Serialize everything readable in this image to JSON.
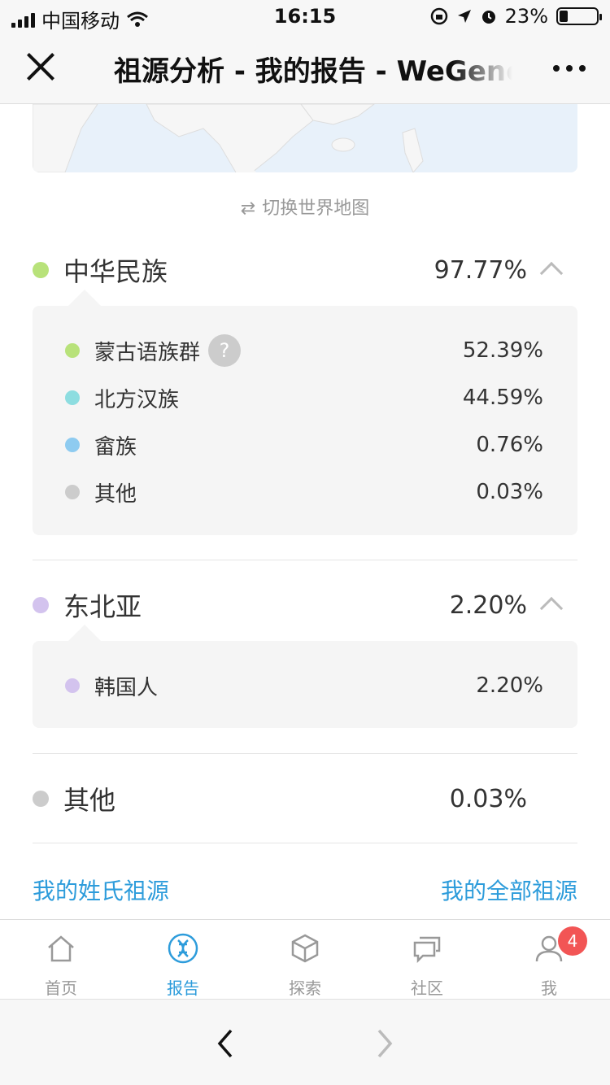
{
  "status_bar": {
    "carrier": "中国移动",
    "time": "16:15",
    "battery": "23%"
  },
  "nav": {
    "title": "祖源分析 - 我的报告 - WeGene"
  },
  "switch_map": {
    "icon": "swap-icon",
    "label": "切换世界地图"
  },
  "regions": [
    {
      "name": "中华民族",
      "percent": "97.77%",
      "color": "#b8e27a",
      "items": [
        {
          "name": "蒙古语族群",
          "percent": "52.39%",
          "color": "#b8e27a",
          "help": "?"
        },
        {
          "name": "北方汉族",
          "percent": "44.59%",
          "color": "#8ddde0"
        },
        {
          "name": "畲族",
          "percent": "0.76%",
          "color": "#8ecbf0"
        },
        {
          "name": "其他",
          "percent": "0.03%",
          "color": "#cccccc"
        }
      ]
    },
    {
      "name": "东北亚",
      "percent": "2.20%",
      "color": "#d3c3ee",
      "items": [
        {
          "name": "韩国人",
          "percent": "2.20%",
          "color": "#d3c3ee"
        }
      ]
    },
    {
      "name": "其他",
      "percent": "0.03%",
      "color": "#cccccc"
    }
  ],
  "links": {
    "surname": "我的姓氏祖源",
    "all": "我的全部祖源"
  },
  "tabs": [
    {
      "label": "首页",
      "icon": "home-icon"
    },
    {
      "label": "报告",
      "icon": "dna-icon"
    },
    {
      "label": "探索",
      "icon": "cube-icon"
    },
    {
      "label": "社区",
      "icon": "chat-icon"
    },
    {
      "label": "我",
      "icon": "user-icon",
      "badge": "4"
    }
  ],
  "accent": "#2d9cdb"
}
